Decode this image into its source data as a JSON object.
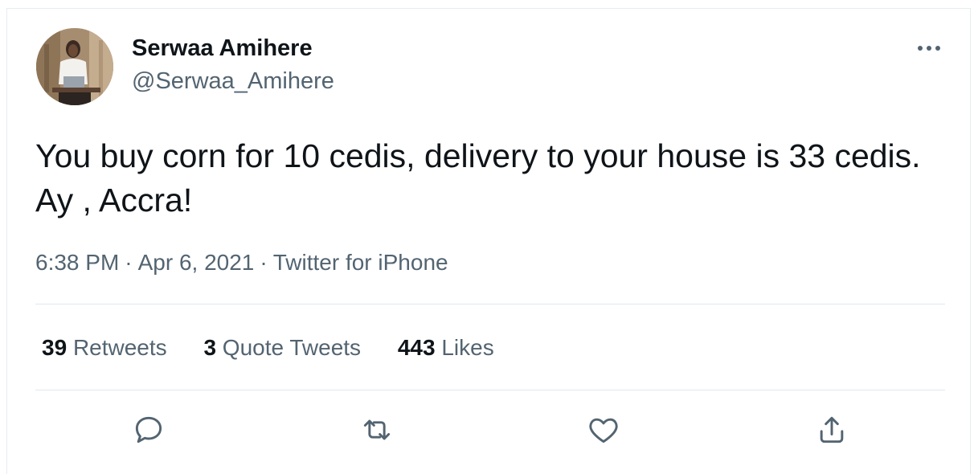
{
  "tweet": {
    "author": {
      "display_name": "Serwaa Amihere",
      "handle": "@Serwaa_Amihere"
    },
    "text": "You buy corn for 10 cedis, delivery to your house is 33 cedis. Ay , Accra!",
    "time": "6:38 PM",
    "date": "Apr 6, 2021",
    "separator": "·",
    "source": "Twitter for iPhone",
    "stats": {
      "retweets": {
        "count": "39",
        "label": "Retweets"
      },
      "quote_tweets": {
        "count": "3",
        "label": "Quote Tweets"
      },
      "likes": {
        "count": "443",
        "label": "Likes"
      }
    },
    "actions": [
      "reply-icon",
      "retweet-icon",
      "like-icon",
      "share-icon"
    ]
  },
  "colors": {
    "text_primary": "#0f1419",
    "text_secondary": "#536471",
    "divider": "#e1e8ed"
  }
}
